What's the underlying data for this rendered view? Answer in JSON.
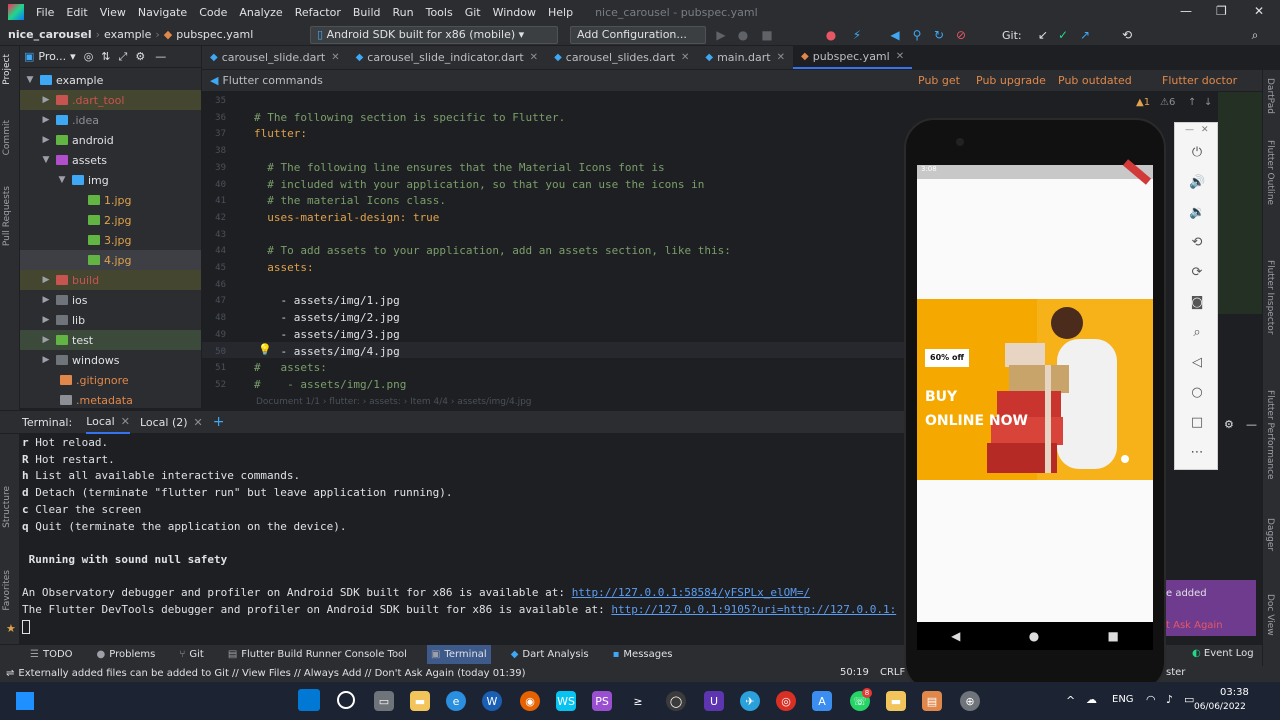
{
  "menubar": {
    "items": [
      "File",
      "Edit",
      "View",
      "Navigate",
      "Code",
      "Analyze",
      "Refactor",
      "Build",
      "Run",
      "Tools",
      "Git",
      "Window",
      "Help"
    ],
    "window_title": "nice_carousel - pubspec.yaml"
  },
  "navbar": {
    "project": "nice_carousel",
    "folder": "example",
    "file": "pubspec.yaml",
    "device": "Android SDK built for x86 (mobile)",
    "config": "Add Configuration...",
    "git_label": "Git:"
  },
  "project_panel": {
    "title": "Pro...",
    "tree": [
      {
        "label": "example",
        "depth": 0,
        "open": true
      },
      {
        "label": ".dart_tool",
        "depth": 1,
        "open": false
      },
      {
        "label": ".idea",
        "depth": 1,
        "open": false
      },
      {
        "label": "android",
        "depth": 1,
        "open": false
      },
      {
        "label": "assets",
        "depth": 1,
        "open": true
      },
      {
        "label": "img",
        "depth": 2,
        "open": true
      },
      {
        "label": "1.jpg",
        "depth": 3
      },
      {
        "label": "2.jpg",
        "depth": 3
      },
      {
        "label": "3.jpg",
        "depth": 3
      },
      {
        "label": "4.jpg",
        "depth": 3
      },
      {
        "label": "build",
        "depth": 1,
        "open": false
      },
      {
        "label": "ios",
        "depth": 1,
        "open": false
      },
      {
        "label": "lib",
        "depth": 1,
        "open": false
      },
      {
        "label": "test",
        "depth": 1,
        "open": false
      },
      {
        "label": "windows",
        "depth": 1,
        "open": false
      },
      {
        "label": ".gitignore",
        "depth": 1
      },
      {
        "label": ".metadata",
        "depth": 1
      }
    ]
  },
  "left_strip": [
    "Project",
    "Commit",
    "Pull Requests",
    "Structure",
    "Favorites"
  ],
  "tabs": [
    {
      "label": "carousel_slide.dart"
    },
    {
      "label": "carousel_slide_indicator.dart"
    },
    {
      "label": "carousel_slides.dart"
    },
    {
      "label": "main.dart"
    },
    {
      "label": "pubspec.yaml"
    }
  ],
  "flutter_commands": {
    "label": "Flutter commands",
    "actions": [
      "Pub get",
      "Pub upgrade",
      "Pub outdated",
      "Flutter doctor"
    ]
  },
  "code": {
    "line_numbers": [
      "35",
      "36",
      "37",
      "38",
      "39",
      "40",
      "41",
      "42",
      "43",
      "44",
      "45",
      "46",
      "47",
      "48",
      "49",
      "50",
      "51",
      "52"
    ],
    "lines": [
      {
        "t": "",
        "c": "val"
      },
      {
        "t": "# The following section is specific to Flutter.",
        "c": "cmt"
      },
      {
        "t": "flutter:",
        "c": "key"
      },
      {
        "t": "",
        "c": "val"
      },
      {
        "t": "  # The following line ensures that the Material Icons font is",
        "c": "cmt"
      },
      {
        "t": "  # included with your application, so that you can use the icons in",
        "c": "cmt"
      },
      {
        "t": "  # the material Icons class.",
        "c": "cmt"
      },
      {
        "t": "  uses-material-design: true",
        "c": "key"
      },
      {
        "t": "",
        "c": "val"
      },
      {
        "t": "  # To add assets to your application, add an assets section, like this:",
        "c": "cmt"
      },
      {
        "t": "  assets:",
        "c": "key"
      },
      {
        "t": "",
        "c": "val"
      },
      {
        "t": "    - assets/img/1.jpg",
        "c": "val"
      },
      {
        "t": "    - assets/img/2.jpg",
        "c": "val"
      },
      {
        "t": "    - assets/img/3.jpg",
        "c": "val"
      },
      {
        "t": "    - assets/img/4.jpg",
        "c": "val"
      },
      {
        "t": "#   assets:",
        "c": "cmt"
      },
      {
        "t": "#    - assets/img/1.png",
        "c": "cmt"
      }
    ],
    "breadcrumb": "Document 1/1  ›  flutter:  ›  assets:  ›  Item 4/4  ›  assets/img/4.jpg"
  },
  "terminal": {
    "label": "Terminal:",
    "tabs": [
      "Local",
      "Local (2)"
    ],
    "lines": [
      {
        "k": "r",
        "t": " Hot reload."
      },
      {
        "k": "R",
        "t": " Hot restart."
      },
      {
        "k": "h",
        "t": " List all available interactive commands."
      },
      {
        "k": "d",
        "t": " Detach (terminate \"flutter run\" but leave application running)."
      },
      {
        "k": "c",
        "t": " Clear the screen"
      },
      {
        "k": "q",
        "t": " Quit (terminate the application on the device)."
      },
      {
        "k": "",
        "t": ""
      },
      {
        "k": "",
        "t": " Running with sound null safety"
      },
      {
        "k": "",
        "t": ""
      },
      {
        "k": "",
        "t": "An Observatory debugger and profiler on Android SDK built for x86 is available at: ",
        "link": "http://127.0.0.1:58584/yFSPLx_elOM=/"
      },
      {
        "k": "",
        "t": "The Flutter DevTools debugger and profiler on Android SDK built for x86 is available at: ",
        "link": "http://127.0.0.1:9105?uri=http://127.0.0.1:"
      }
    ]
  },
  "toolwindows": [
    "TODO",
    "Problems",
    "Git",
    "Flutter Build Runner Console Tool",
    "Terminal",
    "Dart Analysis",
    "Messages"
  ],
  "status": {
    "message": "Externally added files can be added to Git // View Files // Always Add // Don't Ask Again (today 01:39)",
    "position": "50:19",
    "encoding": "CRLF",
    "branch": "ster",
    "event_log": "Event Log"
  },
  "right_strip": [
    "DartPad",
    "Flutter Outline",
    "Flutter Inspector",
    "Flutter Performance",
    "Dagger",
    "Doc View"
  ],
  "phone": {
    "status_time": "3:08",
    "badge": "60% off",
    "headline1": "BUY",
    "headline2": "ONLINE NOW"
  },
  "notification": {
    "line1": "e added",
    "line2": "t Ask Again"
  },
  "taskbar": {
    "lang": "ENG",
    "time": "03:38",
    "date": "06/06/2022"
  }
}
